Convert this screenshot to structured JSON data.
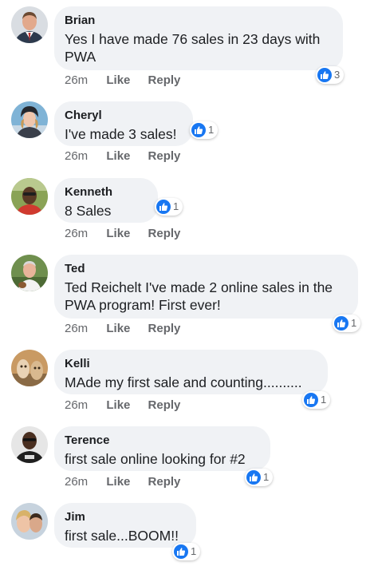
{
  "colors": {
    "bubble": "#f0f2f5",
    "meta_text": "#65676b",
    "like_blue": "#1877f2"
  },
  "comments": [
    {
      "author": "Brian",
      "text": "Yes I have made 76 sales in 23 days with PWA",
      "time": "26m",
      "like_label": "Like",
      "reply_label": "Reply",
      "reaction_count": "3",
      "reaction_icon": "thumbs-up-icon"
    },
    {
      "author": "Cheryl",
      "text": "I've made 3 sales!",
      "time": "26m",
      "like_label": "Like",
      "reply_label": "Reply",
      "reaction_count": "1",
      "reaction_icon": "thumbs-up-icon"
    },
    {
      "author": "Kenneth",
      "text": "8 Sales",
      "time": "26m",
      "like_label": "Like",
      "reply_label": "Reply",
      "reaction_count": "1",
      "reaction_icon": "thumbs-up-icon"
    },
    {
      "author": "Ted",
      "text": "Ted Reichelt I've made 2 online sales in the PWA program! First ever!",
      "time": "26m",
      "like_label": "Like",
      "reply_label": "Reply",
      "reaction_count": "1",
      "reaction_icon": "thumbs-up-icon"
    },
    {
      "author": "Kelli",
      "text": "MAde my first sale and counting..........",
      "time": "26m",
      "like_label": "Like",
      "reply_label": "Reply",
      "reaction_count": "1",
      "reaction_icon": "thumbs-up-icon"
    },
    {
      "author": "Terence",
      "text": "first sale online looking for #2",
      "time": "26m",
      "like_label": "Like",
      "reply_label": "Reply",
      "reaction_count": "1",
      "reaction_icon": "thumbs-up-icon"
    },
    {
      "author": "Jim",
      "text": "first sale...BOOM!!",
      "reaction_count": "1",
      "reaction_icon": "thumbs-up-icon"
    }
  ]
}
